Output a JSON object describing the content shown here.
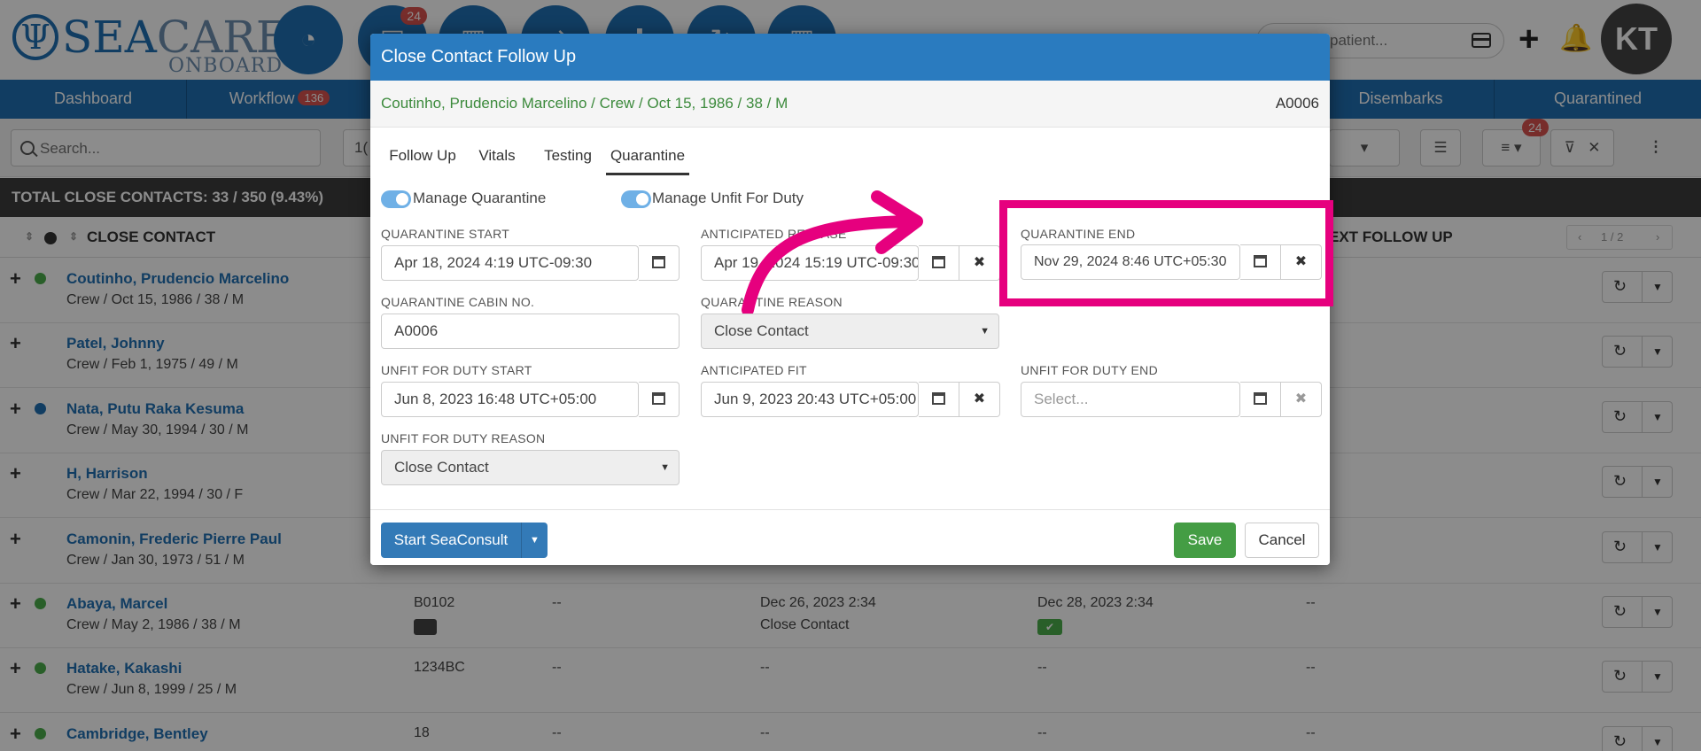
{
  "header": {
    "logo_main": "SEA",
    "logo_light": "CARE",
    "logo_sub": "ONBOARD",
    "workflow_badge": "24",
    "search_placeholder": "patient...",
    "avatar_initials": "KT"
  },
  "nav": {
    "items": [
      {
        "label": "Dashboard"
      },
      {
        "label": "Workflow",
        "badge": "136"
      },
      {
        "label": "Disembarks"
      },
      {
        "label": "Quarantined"
      }
    ]
  },
  "toolbar": {
    "search_placeholder": "Search...",
    "badge": "24",
    "partial_value": "1("
  },
  "totals": {
    "text": "TOTAL CLOSE CONTACTS: 33 / 350 (9.43%)"
  },
  "columns": {
    "close_contact": "CLOSE CONTACT",
    "next_follow_up": "EXT FOLLOW UP",
    "pager": "1 / 2"
  },
  "rows": [
    {
      "name": "Coutinho, Prudencio Marcelino",
      "detail": "Crew / Oct 15, 1986 / 38 / M",
      "status": "#4cae4c",
      "cabin": "",
      "c3": "",
      "c4": "",
      "c4b": "",
      "c5": "",
      "c6": ""
    },
    {
      "name": "Patel, Johnny",
      "detail": "Crew / Feb 1, 1975 / 49 / M",
      "status": "",
      "cabin": "",
      "c3": "",
      "c4": "",
      "c4b": "",
      "c5": "",
      "c6": ""
    },
    {
      "name": "Nata, Putu Raka Kesuma",
      "detail": "Crew / May 30, 1994 / 30 / M",
      "status": "#1f6fb3",
      "cabin": "",
      "c3": "",
      "c4": "",
      "c4b": "",
      "c5": "",
      "c6": ""
    },
    {
      "name": "H, Harrison",
      "detail": "Crew / Mar 22, 1994 / 30 / F",
      "status": "",
      "cabin": "",
      "c3": "",
      "c4": "",
      "c4b": "",
      "c5": "",
      "c6": ""
    },
    {
      "name": "Camonin, Frederic Pierre Paul",
      "detail": "Crew / Jan 30, 1973 / 51 / M",
      "status": "",
      "cabin": "",
      "c3": "",
      "c4": "",
      "c4b": "",
      "c5": "",
      "c6": ""
    },
    {
      "name": "Abaya, Marcel",
      "detail": "Crew / May 2, 1986 / 38 / M",
      "status": "#4cae4c",
      "cabin": "B0102",
      "c3": "--",
      "c4": "Dec 26, 2023 2:34",
      "c4b": "Close Contact",
      "c5": "Dec 28, 2023 2:34",
      "c6": "--"
    },
    {
      "name": "Hatake, Kakashi",
      "detail": "Crew / Jun 8, 1999 / 25 / M",
      "status": "#4cae4c",
      "cabin": "1234BC",
      "c3": "--",
      "c4": "--",
      "c4b": "",
      "c5": "--",
      "c6": "--"
    },
    {
      "name": "Cambridge, Bentley",
      "detail": "",
      "status": "#4cae4c",
      "cabin": "18",
      "c3": "--",
      "c4": "--",
      "c4b": "",
      "c5": "--",
      "c6": "--"
    }
  ],
  "modal": {
    "title": "Close Contact Follow Up",
    "patient_info": "Coutinho, Prudencio Marcelino / Crew / Oct 15, 1986 / 38 / M",
    "patient_id": "A0006",
    "tabs": [
      "Follow Up",
      "Vitals",
      "Testing",
      "Quarantine"
    ],
    "active_tab": "Quarantine",
    "toggles": {
      "manage_quarantine": "Manage Quarantine",
      "manage_unfit": "Manage Unfit For Duty"
    },
    "fields": {
      "quarantine_start": {
        "label": "QUARANTINE START",
        "value": "Apr 18, 2024 4:19 UTC-09:30"
      },
      "anticipated_release": {
        "label": "ANTICIPATED RELEASE",
        "value": "Apr 19, 2024 15:19 UTC-09:30"
      },
      "quarantine_end": {
        "label": "QUARANTINE END",
        "value": "Nov 29, 2024 8:46 UTC+05:30"
      },
      "quarantine_cabin": {
        "label": "QUARANTINE CABIN NO.",
        "value": "A0006"
      },
      "quarantine_reason": {
        "label": "QUARANTINE REASON",
        "value": "Close Contact"
      },
      "unfit_start": {
        "label": "UNFIT FOR DUTY START",
        "value": "Jun 8, 2023 16:48 UTC+05:00"
      },
      "anticipated_fit": {
        "label": "ANTICIPATED FIT",
        "value": "Jun 9, 2023 20:43 UTC+05:00"
      },
      "unfit_end": {
        "label": "UNFIT FOR DUTY END",
        "placeholder": "Select..."
      },
      "unfit_reason": {
        "label": "UNFIT FOR DUTY REASON",
        "value": "Close Contact"
      }
    },
    "buttons": {
      "start_consult": "Start SeaConsult",
      "save": "Save",
      "cancel": "Cancel"
    }
  },
  "colors": {
    "brand_blue": "#1f6fb3",
    "modal_header": "#2a7bbf",
    "highlight": "#e6007e",
    "save_green": "#449d44",
    "badge_red": "#d9534f"
  }
}
